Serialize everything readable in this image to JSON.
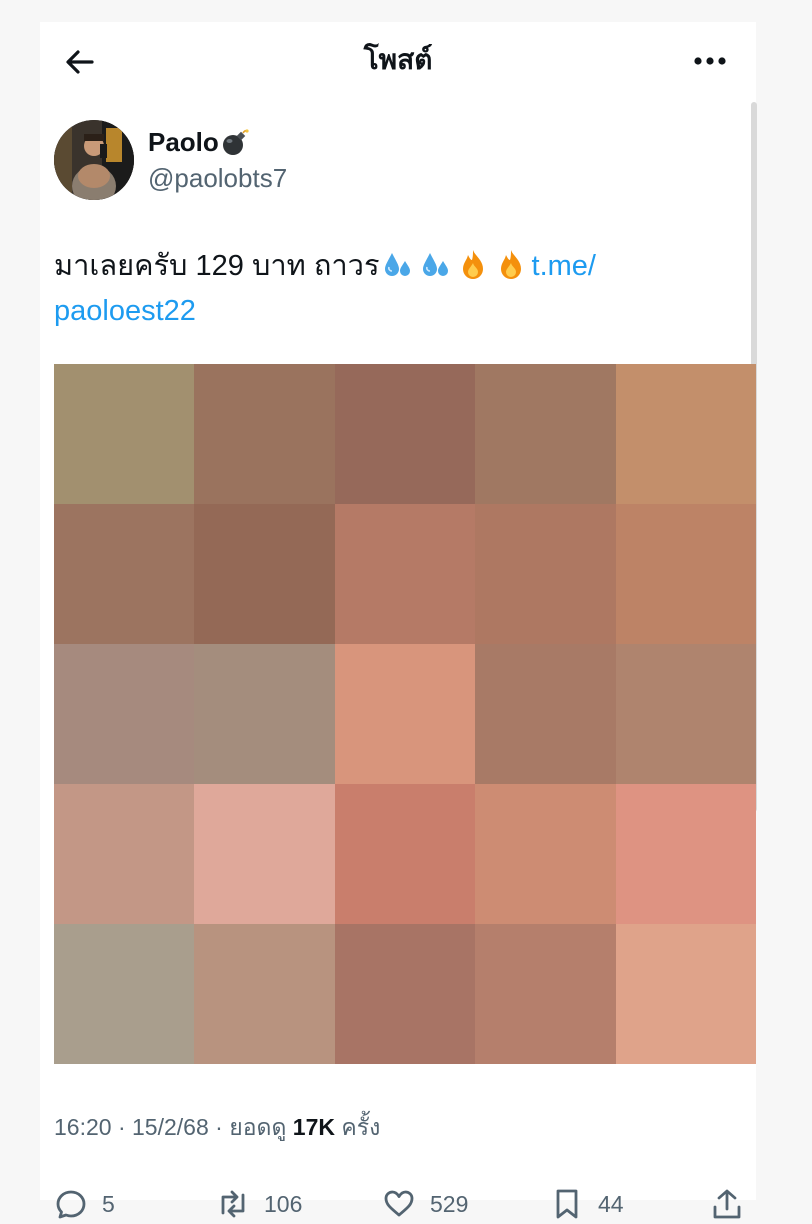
{
  "header": {
    "title": "โพสต์"
  },
  "author": {
    "display_name": "Paolo",
    "handle": "@paolobts7"
  },
  "tweet": {
    "text": "มาเลยครับ 129 บาท ถาวร",
    "emoji": [
      "sweat-droplets",
      "sweat-droplets",
      "fire",
      "fire"
    ],
    "link_line1": "t.me/",
    "link_line2": "paoloest22"
  },
  "media": {
    "colors": [
      "#a2906f",
      "#9a735e",
      "#96695a",
      "#a07862",
      "#c38f6b",
      "#9c7460",
      "#946956",
      "#b57a66",
      "#ae7862",
      "#bd8366",
      "#a68a7e",
      "#a48d7d",
      "#d8957c",
      "#a87a66",
      "#af846e",
      "#c39786",
      "#dfa89a",
      "#c97e6c",
      "#cd8c73",
      "#de9382",
      "#a99e8d",
      "#b8937f",
      "#a87465",
      "#b57f6c",
      "#dfa38a"
    ]
  },
  "meta": {
    "time": "16:20",
    "date": "15/2/68",
    "views_label": "ยอดดู",
    "views_count": "17K",
    "views_unit": "ครั้ง",
    "separator": "·"
  },
  "actions": {
    "replies": "5",
    "reposts": "106",
    "likes": "529",
    "bookmarks": "44"
  },
  "colors": {
    "text": "#0f1419",
    "secondary": "#536471",
    "link": "#1d9bf0"
  }
}
